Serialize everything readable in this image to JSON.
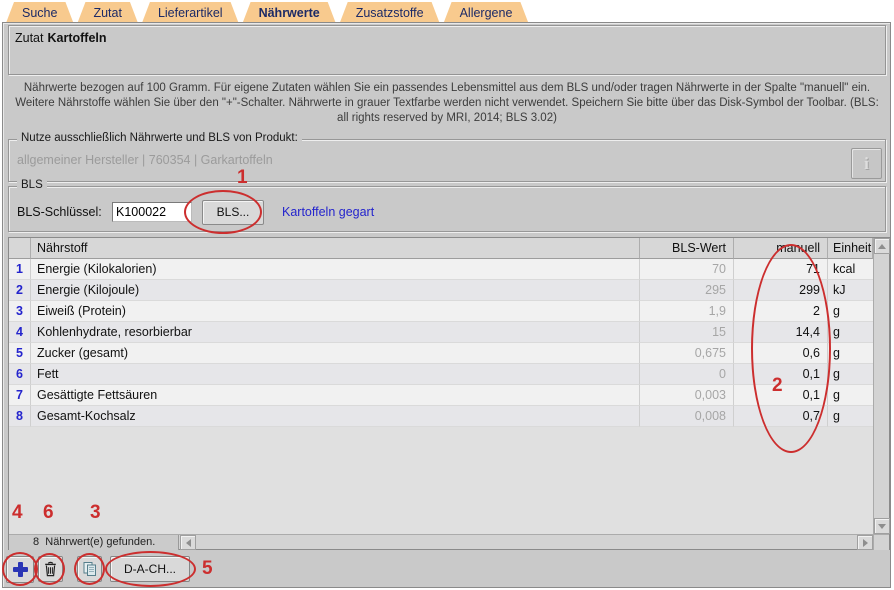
{
  "tabs": [
    {
      "label": "Suche",
      "active": false
    },
    {
      "label": "Zutat",
      "active": false
    },
    {
      "label": "Lieferartikel",
      "active": false
    },
    {
      "label": "Nährwerte",
      "active": true
    },
    {
      "label": "Zusatzstoffe",
      "active": false
    },
    {
      "label": "Allergene",
      "active": false
    }
  ],
  "zutat_box": {
    "label": "Zutat",
    "value": "Kartoffeln"
  },
  "instructions": "Nährwerte bezogen auf 100 Gramm. Für eigene Zutaten wählen Sie ein passendes Lebensmittel aus dem BLS und/oder tragen Nährwerte in der Spalte \"manuell\" ein. Weitere Nährstoffe wählen Sie über den \"+\"-Schalter. Nährwerte in grauer Textfarbe werden nicht verwendet. Speichern Sie bitte über das Disk-Symbol der Toolbar. (BLS: all rights reserved by MRI, 2014; BLS 3.02)",
  "product_box": {
    "legend": "Nutze ausschließlich Nährwerte und BLS von Produkt:",
    "value": "allgemeiner Hersteller | 760354 | Garkartoffeln",
    "info_button": "i"
  },
  "bls_box": {
    "legend": "BLS",
    "field_label": "BLS-Schlüssel:",
    "field_value": "K100022",
    "button_label": "BLS...",
    "food_name": "Kartoffeln gegart"
  },
  "table": {
    "columns": [
      "Nährstoff",
      "BLS-Wert",
      "manuell",
      "Einheit"
    ],
    "rows": [
      {
        "nr": "1",
        "name": "Energie (Kilokalorien)",
        "bls": "70",
        "manuell": "71",
        "einheit": "kcal"
      },
      {
        "nr": "2",
        "name": "Energie (Kilojoule)",
        "bls": "295",
        "manuell": "299",
        "einheit": "kJ"
      },
      {
        "nr": "3",
        "name": "Eiweiß (Protein)",
        "bls": "1,9",
        "manuell": "2",
        "einheit": "g"
      },
      {
        "nr": "4",
        "name": "Kohlenhydrate, resorbierbar",
        "bls": "15",
        "manuell": "14,4",
        "einheit": "g"
      },
      {
        "nr": "5",
        "name": "Zucker (gesamt)",
        "bls": "0,675",
        "manuell": "0,6",
        "einheit": "g"
      },
      {
        "nr": "6",
        "name": "Fett",
        "bls": "0",
        "manuell": "0,1",
        "einheit": "g"
      },
      {
        "nr": "7",
        "name": "Gesättigte Fettsäuren",
        "bls": "0,003",
        "manuell": "0,1",
        "einheit": "g"
      },
      {
        "nr": "8",
        "name": "Gesamt-Kochsalz",
        "bls": "0,008",
        "manuell": "0,7",
        "einheit": "g"
      }
    ]
  },
  "status_bar": {
    "count": "8",
    "text": "Nährwert(e) gefunden."
  },
  "toolbar": {
    "dach_button_label": "D-A-CH...",
    "icons": {
      "add": "plus-icon",
      "delete": "trash-icon",
      "copy": "copy-icon"
    }
  },
  "annotations": {
    "color": "#cc2e2e",
    "items": [
      {
        "label": "1",
        "target": "BLS-Button"
      },
      {
        "label": "2",
        "target": "manuell-Spalte"
      },
      {
        "label": "3",
        "target": "Kopieren-Button"
      },
      {
        "label": "4",
        "target": "Hinzufügen-Button"
      },
      {
        "label": "5",
        "target": "D-A-CH-Button"
      },
      {
        "label": "6",
        "target": "Löschen-Button"
      }
    ]
  },
  "colors": {
    "tab_fill": "#f8ca8e",
    "tab_text": "#1c2a66",
    "panel_bg": "#c9c9c9",
    "link_blue": "#2424cd",
    "disabled_text": "#9b9b9b",
    "annotation_red": "#cc2e2e"
  }
}
